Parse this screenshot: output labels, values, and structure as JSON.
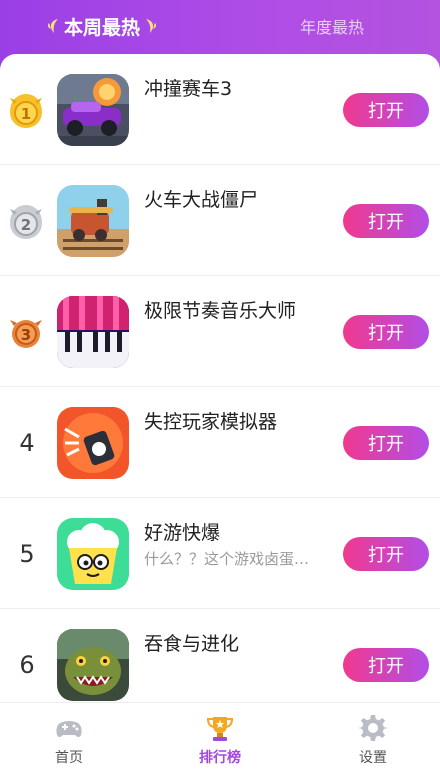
{
  "header": {
    "tabs": [
      {
        "label": "本周最热",
        "active": true
      },
      {
        "label": "年度最热",
        "active": false
      }
    ]
  },
  "colors": {
    "accent": "#a347e0",
    "button_gradient_start": "#f0398e",
    "button_gradient_end": "#b24ee6",
    "header_gradient_start": "#9a3fe6",
    "header_gradient_end": "#b353df"
  },
  "ranking": {
    "items": [
      {
        "rank": "1",
        "medal": "gold-medal-icon",
        "name": "冲撞赛车3",
        "desc": "",
        "button": "打开",
        "icon": "racing-car-app-icon"
      },
      {
        "rank": "2",
        "medal": "silver-medal-icon",
        "name": "火车大战僵尸",
        "desc": "",
        "button": "打开",
        "icon": "train-app-icon"
      },
      {
        "rank": "3",
        "medal": "bronze-medal-icon",
        "name": "极限节奏音乐大师",
        "desc": "",
        "button": "打开",
        "icon": "piano-app-icon"
      },
      {
        "rank": "4",
        "medal": "",
        "name": "失控玩家模拟器",
        "desc": "",
        "button": "打开",
        "icon": "bomb-app-icon"
      },
      {
        "rank": "5",
        "medal": "",
        "name": "好游快爆",
        "desc": "什么？？这个游戏卤蛋…",
        "button": "打开",
        "icon": "popcorn-app-icon"
      },
      {
        "rank": "6",
        "medal": "",
        "name": "吞食与进化",
        "desc": "",
        "button": "打开",
        "icon": "dinosaur-app-icon"
      }
    ]
  },
  "bottom_nav": {
    "items": [
      {
        "label": "首页",
        "icon": "gamepad-icon",
        "active": false
      },
      {
        "label": "排行榜",
        "icon": "trophy-icon",
        "active": true
      },
      {
        "label": "设置",
        "icon": "gear-icon",
        "active": false
      }
    ]
  }
}
